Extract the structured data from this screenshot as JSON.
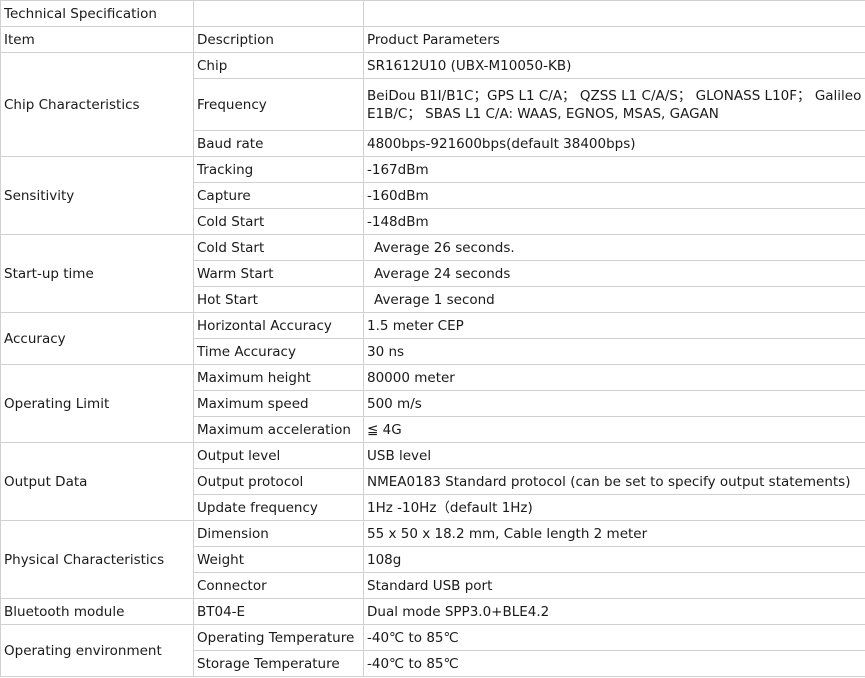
{
  "title": "Technical Specification",
  "headers": {
    "item": "Item",
    "description": "Description",
    "parameters": "Product Parameters"
  },
  "groups": [
    {
      "item": "Chip Characteristics",
      "rows": [
        {
          "description": "Chip",
          "value": "SR1612U10 (UBX-M10050-KB)"
        },
        {
          "description": "Frequency",
          "value": "BeiDou B1I/B1C；GPS L1 C/A； QZSS L1 C/A/S； GLONASS L10F； Galileo E1B/C； SBAS L1 C/A: WAAS, EGNOS, MSAS, GAGAN"
        },
        {
          "description": "Baud rate",
          "value": "4800bps-921600bps(default 38400bps)"
        }
      ]
    },
    {
      "item": "Sensitivity",
      "rows": [
        {
          "description": "Tracking",
          "value": "-167dBm"
        },
        {
          "description": "Capture",
          "value": "-160dBm"
        },
        {
          "description": "Cold Start",
          "value": "-148dBm"
        }
      ]
    },
    {
      "item": "Start-up time",
      "rows": [
        {
          "description": "Cold Start",
          "value": "Average 26 seconds."
        },
        {
          "description": "Warm Start",
          "value": "Average 24 seconds"
        },
        {
          "description": "Hot Start",
          "value": "Average 1 second"
        }
      ]
    },
    {
      "item": "Accuracy",
      "rows": [
        {
          "description": "Horizontal Accuracy",
          "value": "1.5 meter CEP"
        },
        {
          "description": "Time Accuracy",
          "value": "30 ns"
        }
      ]
    },
    {
      "item": "Operating Limit",
      "rows": [
        {
          "description": "Maximum height",
          "value": "80000 meter"
        },
        {
          "description": "Maximum speed",
          "value": "500 m/s"
        },
        {
          "description": "Maximum acceleration",
          "value": "≦ 4G"
        }
      ]
    },
    {
      "item": "Output Data",
      "rows": [
        {
          "description": "Output level",
          "value": "USB level"
        },
        {
          "description": "Output protocol",
          "value": "NMEA0183 Standard protocol (can be set to specify output statements)"
        },
        {
          "description": "Update frequency",
          "value": "1Hz -10Hz（default 1Hz)"
        }
      ]
    },
    {
      "item": "Physical Characteristics",
      "rows": [
        {
          "description": "Dimension",
          "value": "55 x 50 x 18.2 mm, Cable length 2 meter"
        },
        {
          "description": "Weight",
          "value": "108g"
        },
        {
          "description": "Connector",
          "value": "Standard USB port"
        }
      ]
    },
    {
      "item": "Bluetooth module",
      "rows": [
        {
          "description": "BT04-E",
          "value": "Dual mode SPP3.0+BLE4.2"
        }
      ]
    },
    {
      "item": "Operating environment",
      "rows": [
        {
          "description": "Operating Temperature",
          "value": "-40℃ to 85℃"
        },
        {
          "description": "Storage Temperature",
          "value": "-40℃ to 85℃"
        }
      ]
    }
  ]
}
